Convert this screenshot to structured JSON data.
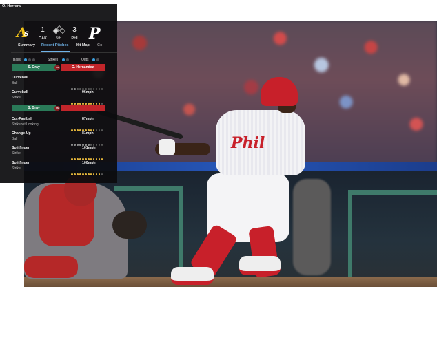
{
  "panel": {
    "player_name": "O. Herrera",
    "score": {
      "away_runs": "1",
      "home_runs": "3",
      "away_abbr": "OAK",
      "home_abbr": "PHI",
      "inning": "5th",
      "away_logo": "athletics-logo",
      "home_logo": "phillies-logo"
    },
    "tabs": [
      "Summary",
      "Recent Pitches",
      "Hit Map",
      "Co"
    ],
    "active_tab": "Recent Pitches",
    "count": {
      "balls_label": "Balls",
      "strikes_label": "Strikes",
      "outs_label": "Outs",
      "balls": 1,
      "strikes": 1,
      "outs": 1
    },
    "matchups": [
      {
        "pitcher": "S. Gray",
        "badge": "vs",
        "batter": "C. Hernandez"
      },
      {
        "pitcher": "S. Gray",
        "badge": "vs",
        "batter": ""
      }
    ],
    "pitches_group1": [
      {
        "name": "Curveball",
        "result": "Ball",
        "speed": ""
      },
      {
        "name": "Curveball",
        "result": "Strike",
        "speed": "96mph"
      }
    ],
    "pitches_group2": [
      {
        "name": "Cut-Fastball",
        "result": "Strikeout Looking",
        "speed": "87mph"
      },
      {
        "name": "Change-Up",
        "result": "Ball",
        "speed": "81mph"
      },
      {
        "name": "Splitfinger",
        "result": "Strike",
        "speed": "101mph"
      },
      {
        "name": "Splitfinger",
        "result": "Strike",
        "speed": "100mph"
      }
    ]
  },
  "colors": {
    "panel_bg": "#0c0c0e",
    "accent_blue": "#6fb3e8",
    "pitcher_green": "#2a7a58",
    "batter_red": "#c2252a",
    "speed_dot_yellow": "#e0b23a"
  },
  "photo": {
    "jersey_text": "Phil"
  }
}
